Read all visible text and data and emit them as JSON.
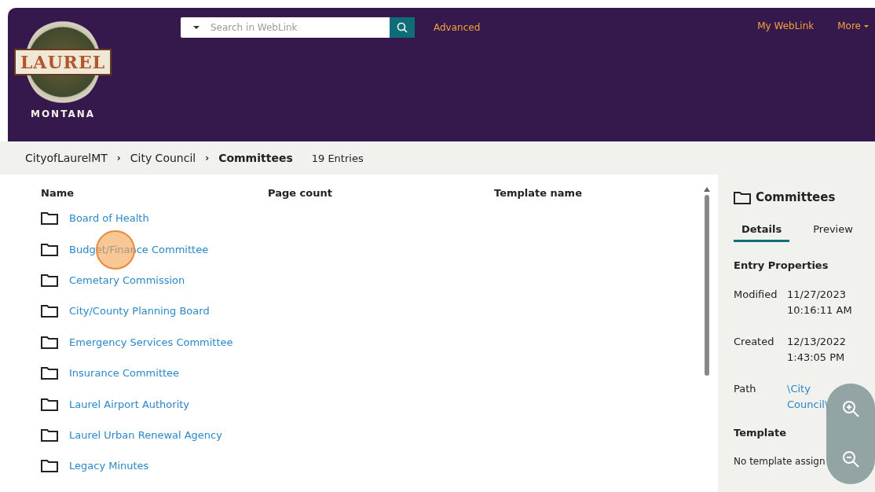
{
  "header": {
    "logo": {
      "title": "LAUREL",
      "subtitle": "MONTANA"
    },
    "search": {
      "placeholder": "Search in WebLink"
    },
    "advanced": "Advanced",
    "links": [
      {
        "label": "My WebLink",
        "kind": "link"
      },
      {
        "label": "More",
        "kind": "menu"
      }
    ]
  },
  "breadcrumb": {
    "separator": "›",
    "items": [
      "CityofLaurelMT",
      "City Council",
      "Committees"
    ],
    "count": "19 Entries"
  },
  "table": {
    "columns": [
      "Name",
      "Page count",
      "Template name"
    ],
    "rows": [
      {
        "name": "Board of Health",
        "clicked": false
      },
      {
        "name": "Budget/Finance Committee",
        "clicked": true
      },
      {
        "name": "Cemetary Commission",
        "clicked": false
      },
      {
        "name": "City/County Planning Board",
        "clicked": false
      },
      {
        "name": "Emergency Services Committee",
        "clicked": false
      },
      {
        "name": "Insurance Committee",
        "clicked": false
      },
      {
        "name": "Laurel Airport Authority",
        "clicked": false
      },
      {
        "name": "Laurel Urban Renewal Agency",
        "clicked": false
      },
      {
        "name": "Legacy Minutes",
        "clicked": false
      }
    ]
  },
  "details": {
    "title": "Committees",
    "tabs": [
      {
        "label": "Details",
        "selected": true
      },
      {
        "label": "Preview",
        "selected": false
      }
    ],
    "section": "Entry Properties",
    "properties": [
      {
        "label": "Modified",
        "value": "11/27/2023 10:16:11 AM",
        "kind": "text"
      },
      {
        "label": "Created",
        "value": "12/13/2022 1:43:05 PM",
        "kind": "text"
      },
      {
        "label": "Path",
        "value": "\\City Council\\",
        "kind": "link"
      }
    ],
    "template_label": "Template",
    "template_value": "No template assign"
  }
}
